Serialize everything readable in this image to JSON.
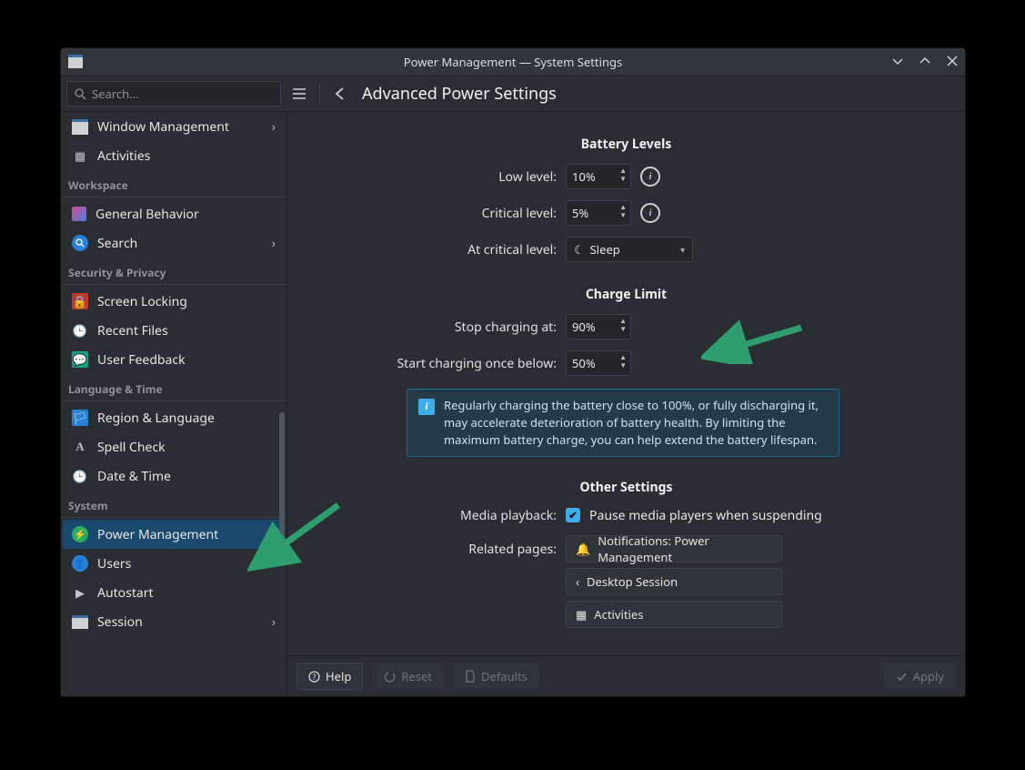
{
  "window": {
    "title": "Power Management — System Settings"
  },
  "toolbar": {
    "search_placeholder": "Search...",
    "page_title": "Advanced Power Settings"
  },
  "sidebar": {
    "groups": [
      {
        "items": [
          {
            "key": "window-management",
            "label": "Window Management",
            "has_arrow": true
          },
          {
            "key": "activities",
            "label": "Activities"
          }
        ]
      },
      {
        "label": "Workspace",
        "items": [
          {
            "key": "general-behavior",
            "label": "General Behavior"
          },
          {
            "key": "search",
            "label": "Search",
            "has_arrow": true
          }
        ]
      },
      {
        "label": "Security & Privacy",
        "items": [
          {
            "key": "screen-locking",
            "label": "Screen Locking"
          },
          {
            "key": "recent-files",
            "label": "Recent Files"
          },
          {
            "key": "user-feedback",
            "label": "User Feedback"
          }
        ]
      },
      {
        "label": "Language & Time",
        "items": [
          {
            "key": "region-language",
            "label": "Region & Language"
          },
          {
            "key": "spell-check",
            "label": "Spell Check"
          },
          {
            "key": "date-time",
            "label": "Date & Time"
          }
        ]
      },
      {
        "label": "System",
        "items": [
          {
            "key": "power-management",
            "label": "Power Management",
            "selected": true
          },
          {
            "key": "users",
            "label": "Users"
          },
          {
            "key": "autostart",
            "label": "Autostart"
          },
          {
            "key": "session",
            "label": "Session",
            "has_arrow": true
          }
        ]
      }
    ]
  },
  "content": {
    "battery_levels": {
      "title": "Battery Levels",
      "low_label": "Low level:",
      "low_value": "10%",
      "critical_label": "Critical level:",
      "critical_value": "5%",
      "at_critical_label": "At critical level:",
      "at_critical_value": "Sleep"
    },
    "charge_limit": {
      "title": "Charge Limit",
      "stop_label": "Stop charging at:",
      "stop_value": "90%",
      "start_label": "Start charging once below:",
      "start_value": "50%",
      "info_text": "Regularly charging the battery close to 100%, or fully discharging it, may accelerate deterioration of battery health. By limiting the maximum battery charge, you can help extend the battery lifespan."
    },
    "other": {
      "title": "Other Settings",
      "media_label": "Media playback:",
      "media_checkbox_label": "Pause media players when suspending",
      "related_label": "Related pages:",
      "links": [
        {
          "key": "notifications",
          "label": "Notifications: Power Management"
        },
        {
          "key": "desktop-session",
          "label": "Desktop Session"
        },
        {
          "key": "activities",
          "label": "Activities"
        }
      ]
    }
  },
  "footer": {
    "help": "Help",
    "reset": "Reset",
    "defaults": "Defaults",
    "apply": "Apply"
  }
}
